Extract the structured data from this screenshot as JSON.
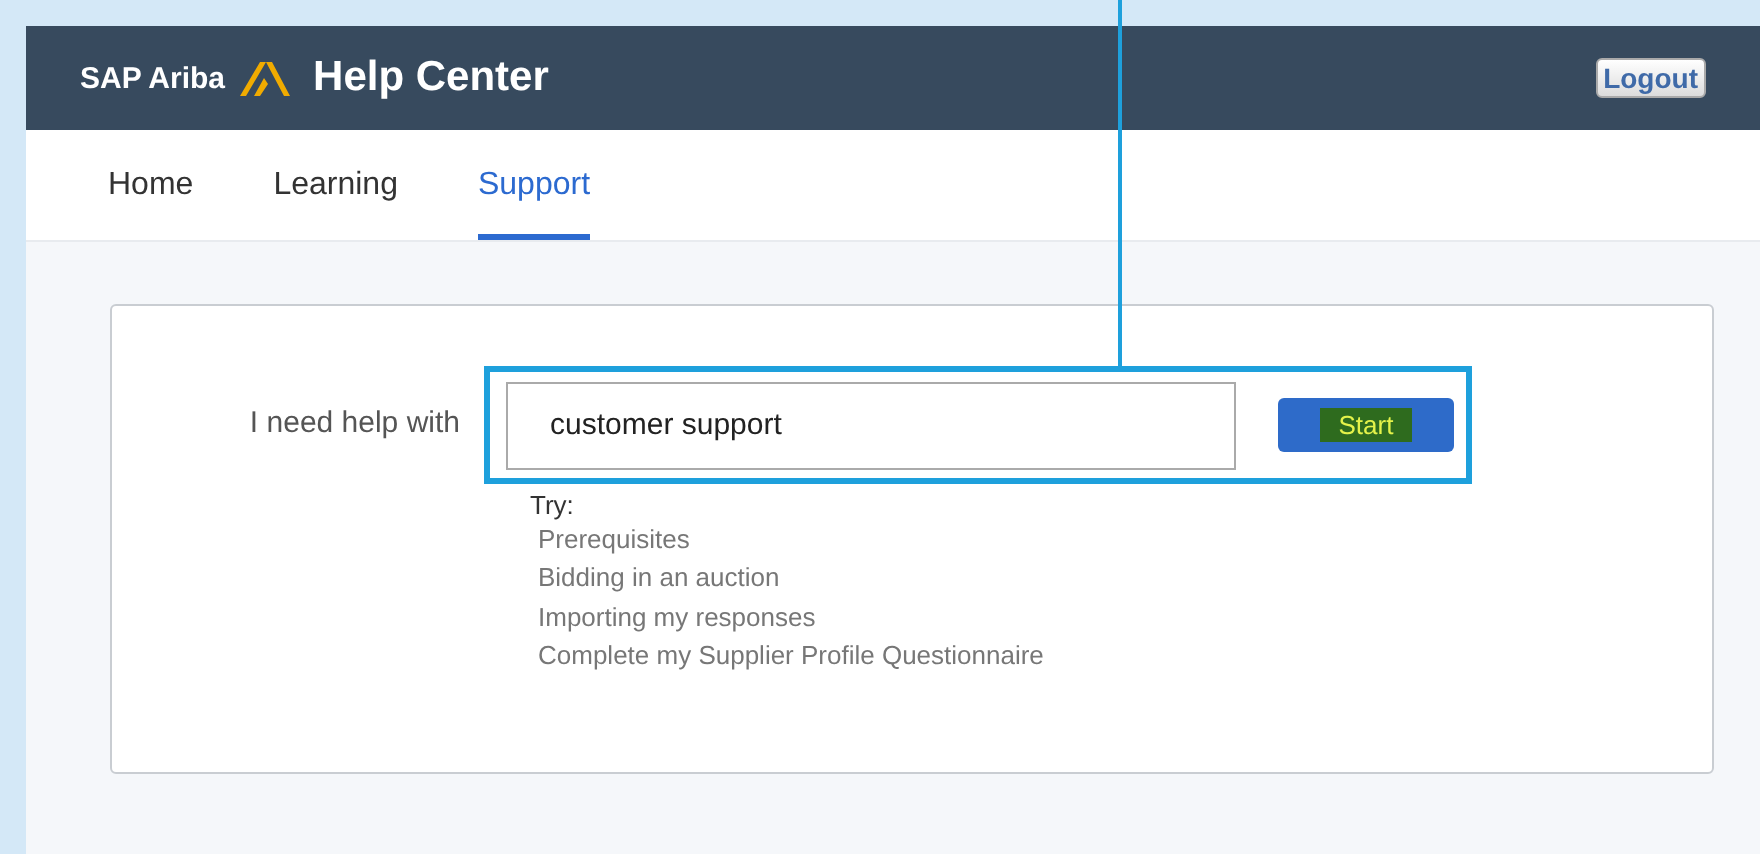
{
  "header": {
    "brand": "SAP Ariba",
    "title": "Help Center",
    "logout": "Logout"
  },
  "tabs": [
    {
      "label": "Home",
      "selected": false
    },
    {
      "label": "Learning",
      "selected": false
    },
    {
      "label": "Support",
      "selected": true
    }
  ],
  "search": {
    "label": "I need help with",
    "value": "customer support",
    "button": "Start"
  },
  "suggestions": {
    "heading": "Try:",
    "items": [
      "Prerequisites",
      "Bidding in an auction",
      "Importing my responses",
      "Complete my Supplier Profile Questionnaire"
    ]
  }
}
